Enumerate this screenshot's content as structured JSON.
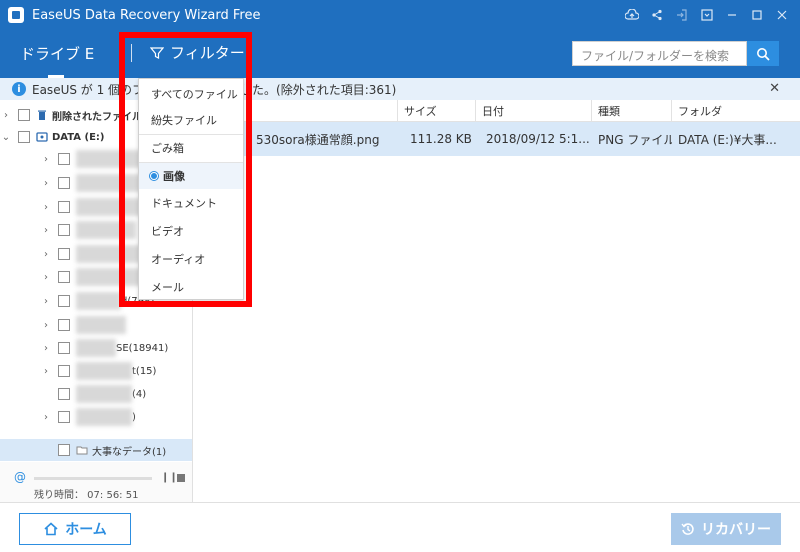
{
  "window": {
    "title": "EaseUS Data Recovery Wizard Free"
  },
  "header": {
    "drive_tab": "ドライブ E",
    "filter_label": "フィルター",
    "search_placeholder": "ファイル/フォルダーを検索"
  },
  "infobar": {
    "text": "EaseUS が 1 個のファイルを見つけました。(除外された項目:361)"
  },
  "tree": {
    "deleted_label": "削除されたファイル",
    "drive_label": "DATA (E:)",
    "partial_labels": [
      "d(798)",
      "SE(18941)",
      "t(15)",
      "(4)",
      ")"
    ],
    "selected_label": "大事なデータ(1)"
  },
  "progress": {
    "remaining": "残り時間： 07: 56: 51",
    "percent": 0
  },
  "list": {
    "headers": [
      "",
      "サイズ",
      "日付",
      "種類",
      "フォルダ"
    ],
    "rows": [
      {
        "name": "530sora様通常顔.png",
        "size": "111.28 KB",
        "date": "2018/09/12 5:1...",
        "type": "PNG ファイル",
        "folder": "DATA (E:)¥大事..."
      }
    ]
  },
  "filter_menu": {
    "items": [
      "すべてのファイル",
      "紛失ファイル",
      "ごみ箱",
      "画像",
      "ドキュメント",
      "ビデオ",
      "オーディオ",
      "メール"
    ],
    "selected": "画像"
  },
  "buttons": {
    "home": "ホーム",
    "recover": "リカバリー"
  },
  "colors": {
    "brand_blue": "#1f6fbf",
    "accent_blue": "#2d8ee0",
    "highlight_red": "#ff0000"
  }
}
